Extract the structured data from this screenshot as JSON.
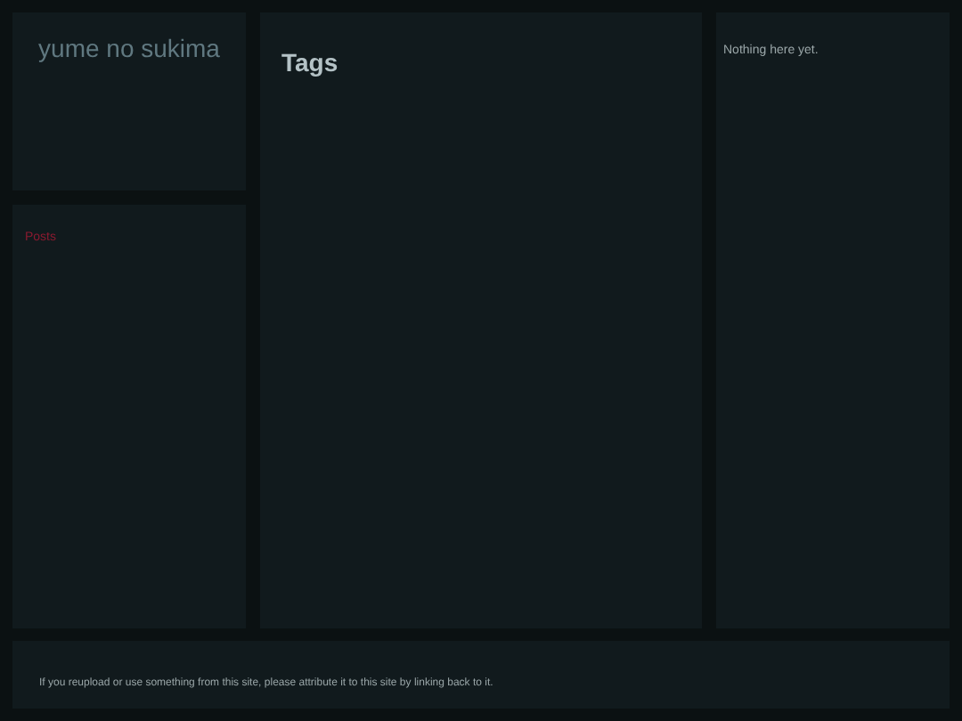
{
  "site_title": "yume no sukima",
  "nav": {
    "links": [
      "Posts"
    ]
  },
  "main": {
    "heading": "Tags"
  },
  "aside": {
    "text": "Nothing here yet."
  },
  "footer": {
    "text": "If you reupload or use something from this site, please attribute it to this site by linking back to it."
  }
}
